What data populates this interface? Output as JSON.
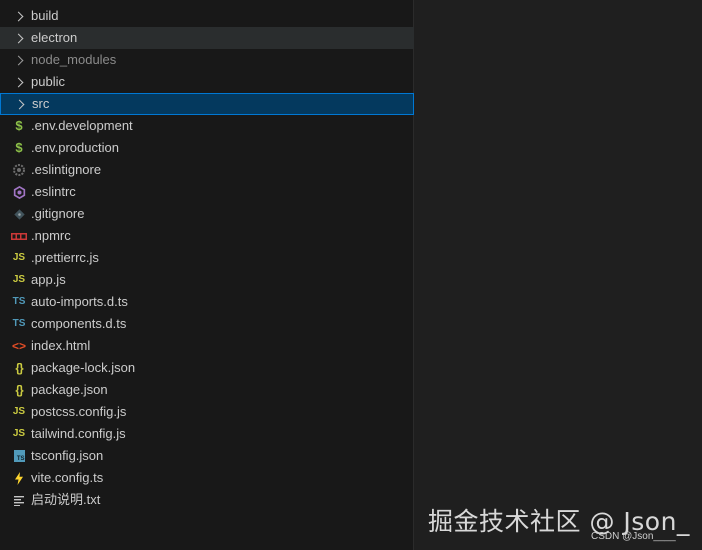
{
  "explorer": {
    "top_fragment": "··",
    "items": [
      {
        "label": "build",
        "kind": "folder",
        "icon": "chevron-right-icon"
      },
      {
        "label": "electron",
        "kind": "folder",
        "icon": "chevron-right-icon",
        "state": "hover"
      },
      {
        "label": "node_modules",
        "kind": "folder",
        "icon": "chevron-right-icon",
        "state": "dim"
      },
      {
        "label": "public",
        "kind": "folder",
        "icon": "chevron-right-icon"
      },
      {
        "label": "src",
        "kind": "folder",
        "icon": "chevron-right-icon",
        "state": "selected"
      },
      {
        "label": ".env.development",
        "kind": "file",
        "icon": "dollar-env-icon",
        "glyph": "$"
      },
      {
        "label": ".env.production",
        "kind": "file",
        "icon": "dollar-env-icon",
        "glyph": "$"
      },
      {
        "label": ".eslintignore",
        "kind": "file",
        "icon": "gear-eslintignore-icon"
      },
      {
        "label": ".eslintrc",
        "kind": "file",
        "icon": "eslint-icon"
      },
      {
        "label": ".gitignore",
        "kind": "file",
        "icon": "git-diamond-icon"
      },
      {
        "label": ".npmrc",
        "kind": "file",
        "icon": "npm-icon"
      },
      {
        "label": ".prettierrc.js",
        "kind": "file",
        "icon": "js-icon",
        "glyph": "JS"
      },
      {
        "label": "app.js",
        "kind": "file",
        "icon": "js-icon",
        "glyph": "JS"
      },
      {
        "label": "auto-imports.d.ts",
        "kind": "file",
        "icon": "ts-icon",
        "glyph": "TS"
      },
      {
        "label": "components.d.ts",
        "kind": "file",
        "icon": "ts-icon",
        "glyph": "TS"
      },
      {
        "label": "index.html",
        "kind": "file",
        "icon": "html-icon",
        "glyph": "<>"
      },
      {
        "label": "package-lock.json",
        "kind": "file",
        "icon": "json-braces-icon",
        "glyph": "{}"
      },
      {
        "label": "package.json",
        "kind": "file",
        "icon": "json-braces-icon",
        "glyph": "{}"
      },
      {
        "label": "postcss.config.js",
        "kind": "file",
        "icon": "js-icon",
        "glyph": "JS"
      },
      {
        "label": "tailwind.config.js",
        "kind": "file",
        "icon": "js-icon",
        "glyph": "JS"
      },
      {
        "label": "tsconfig.json",
        "kind": "file",
        "icon": "tsconfig-icon",
        "glyph": "TS"
      },
      {
        "label": "vite.config.ts",
        "kind": "file",
        "icon": "vite-bolt-icon"
      },
      {
        "label": "启动说明.txt",
        "kind": "file",
        "icon": "text-lines-icon"
      }
    ]
  },
  "watermark": {
    "text": "掘金技术社区 @ Json_",
    "credit": "CSDN @Json____"
  },
  "colors": {
    "sidebar_bg": "#181818",
    "editor_bg": "#1f1f1f",
    "hover_bg": "#2a2d2e",
    "selected_bg": "#04395e",
    "selected_border": "#0078d4",
    "text": "#cccccc",
    "js": "#cbcb41",
    "ts": "#519aba",
    "env": "#8dc149",
    "html": "#e44d26",
    "npm": "#cb3837",
    "eslint": "#a074c4"
  }
}
